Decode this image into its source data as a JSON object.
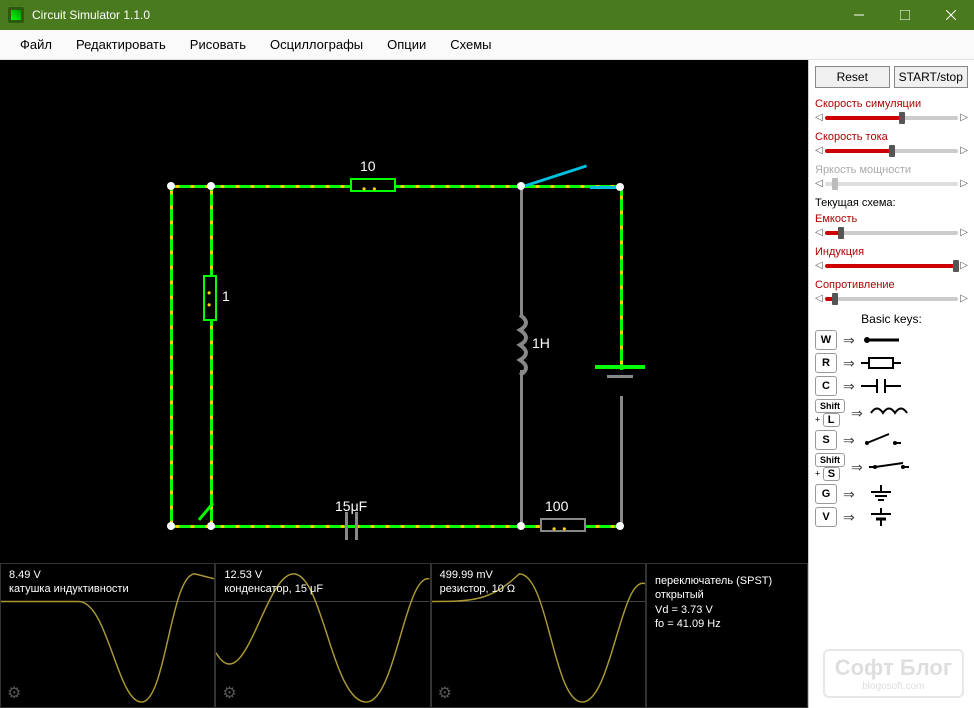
{
  "window": {
    "title": "Circuit Simulator 1.1.0"
  },
  "menu": {
    "items": [
      "Файл",
      "Редактировать",
      "Рисовать",
      "Осциллографы",
      "Опции",
      "Схемы"
    ]
  },
  "controls": {
    "reset": "Reset",
    "startstop": "START/stop",
    "sliders": [
      {
        "label": "Скорость симуляции",
        "pct": 58,
        "muted": false
      },
      {
        "label": "Скорость тока",
        "pct": 50,
        "muted": false
      },
      {
        "label": "Яркость мощности",
        "pct": 8,
        "muted": true
      }
    ],
    "scheme_label": "Текущая схема:",
    "scheme_sliders": [
      {
        "label": "Емкость",
        "pct": 12,
        "muted": false
      },
      {
        "label": "Индукция",
        "pct": 98,
        "muted": false
      },
      {
        "label": "Сопротивление",
        "pct": 8,
        "muted": false
      }
    ],
    "legend_title": "Basic keys:",
    "legend": [
      {
        "key": "W",
        "sym": "wire"
      },
      {
        "key": "R",
        "sym": "resistor"
      },
      {
        "key": "C",
        "sym": "capacitor"
      },
      {
        "combo": "Shift + L",
        "sym": "inductor"
      },
      {
        "key": "S",
        "sym": "switch-open"
      },
      {
        "combo": "Shift + S",
        "sym": "switch-closed"
      },
      {
        "key": "G",
        "sym": "ground"
      },
      {
        "key": "V",
        "sym": "source"
      }
    ]
  },
  "circuit": {
    "r_top": "10",
    "r_left": "1",
    "r_bottom": "100",
    "cap": "15μF",
    "ind": "1H"
  },
  "scopes": [
    {
      "v": "8.49 V",
      "desc": "катушка индуктивности"
    },
    {
      "v": "12.53 V",
      "desc": "конденсатор, 15 μF"
    },
    {
      "v": "499.99 mV",
      "desc": "резистор, 10 Ω"
    }
  ],
  "info": {
    "l1": "переключатель (SPST)",
    "l2": "открытый",
    "l3": "Vd = 3.73 V",
    "l4": "fo = 41.09 Hz"
  },
  "watermark": {
    "main": "Софт Блог",
    "sub": "blogosoft.com"
  }
}
